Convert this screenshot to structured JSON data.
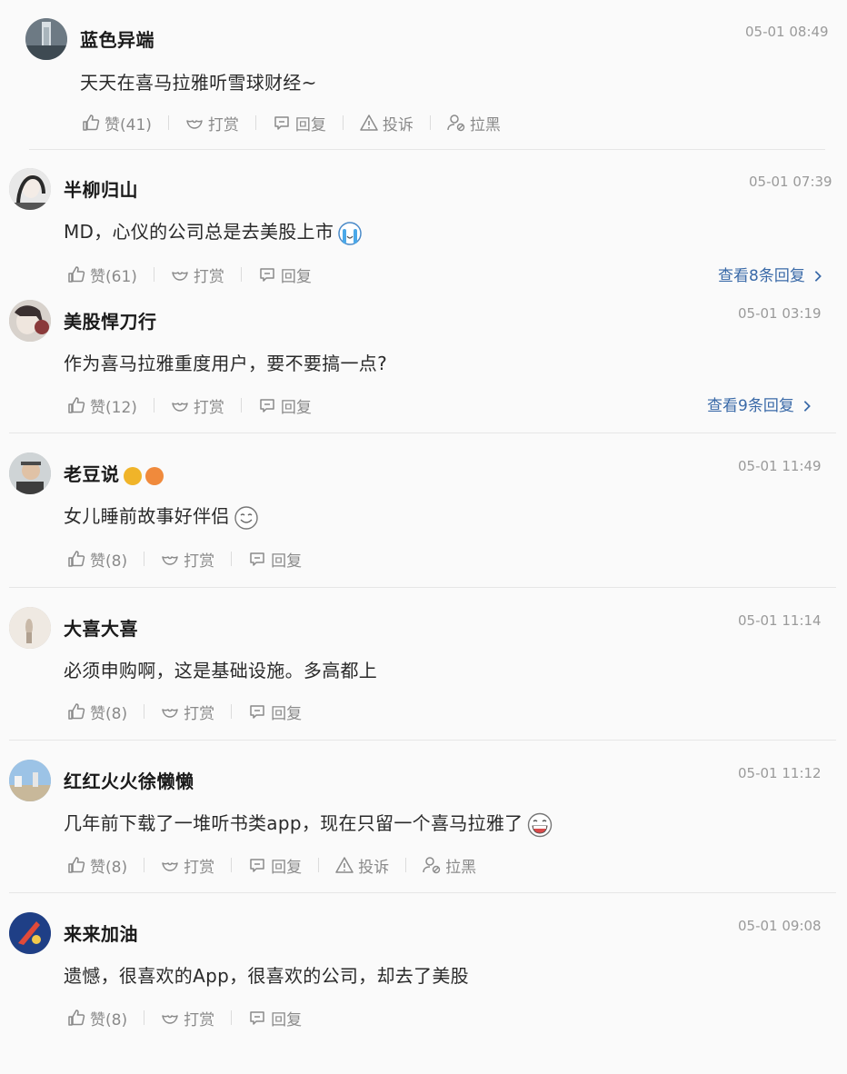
{
  "labels": {
    "tip": "打赏",
    "reply": "回复",
    "report": "投诉",
    "block": "拉黑"
  },
  "comments": [
    {
      "user": "蓝色异端",
      "time": "05-01 08:49",
      "text": "天天在喜马拉雅听雪球财经~",
      "likes": "赞(41)"
    },
    {
      "user": "半柳归山",
      "time": "05-01 07:39",
      "text": "MD，心仪的公司总是去美股上市",
      "likes": "赞(61)",
      "more_replies": "查看8条回复"
    },
    {
      "user": "美股悍刀行",
      "time": "05-01 03:19",
      "text": "作为喜马拉雅重度用户，要不要搞一点?",
      "likes": "赞(12)",
      "more_replies": "查看9条回复"
    },
    {
      "user": "老豆说",
      "time": "05-01 11:49",
      "text": "女儿睡前故事好伴侣",
      "likes": "赞(8)"
    },
    {
      "user": "大喜大喜",
      "time": "05-01 11:14",
      "text": "必须申购啊，这是基础设施。多高都上",
      "likes": "赞(8)"
    },
    {
      "user": "红红火火徐懒懒",
      "time": "05-01 11:12",
      "text": "几年前下载了一堆听书类app，现在只留一个喜马拉雅了",
      "likes": "赞(8)"
    },
    {
      "user": "来来加油",
      "time": "05-01 09:08",
      "text": "遗憾，很喜欢的App，很喜欢的公司，却去了美股",
      "likes": "赞(8)"
    }
  ],
  "colors": {
    "link": "#3a6aa8",
    "muted": "#8a8a8a",
    "time": "#9a9a9a",
    "badge_gold": "#f0b429",
    "badge_orange": "#f08a3c"
  }
}
